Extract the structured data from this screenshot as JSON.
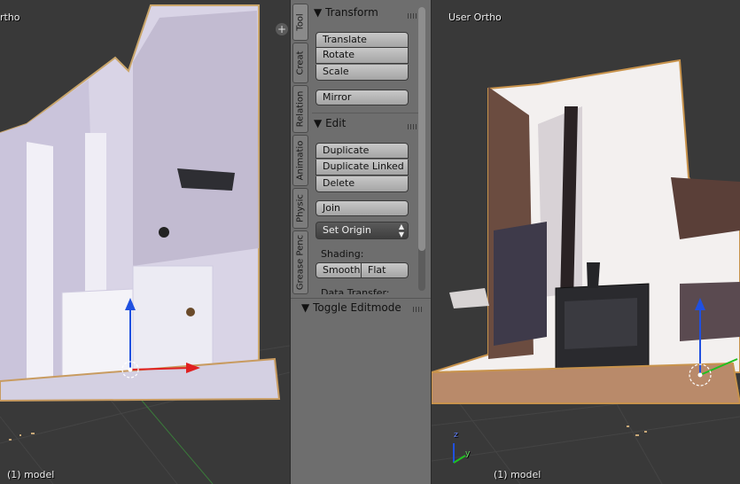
{
  "left_viewport": {
    "title_fragment": "rtho",
    "status": "(1) model"
  },
  "right_viewport": {
    "title": "User Ortho",
    "status": "(1) model",
    "axis_z": "z",
    "axis_y": "y"
  },
  "tool_shelf": {
    "tabs": [
      "Tool",
      "Creat",
      "Relation",
      "Animatio",
      "Physic",
      "Grease Penc"
    ],
    "transform": {
      "header": "Transform",
      "translate": "Translate",
      "rotate": "Rotate",
      "scale": "Scale",
      "mirror": "Mirror"
    },
    "edit": {
      "header": "Edit",
      "duplicate": "Duplicate",
      "duplicate_linked": "Duplicate Linked",
      "delete": "Delete",
      "join": "Join",
      "set_origin": "Set Origin",
      "shading_label": "Shading:",
      "smooth": "Smooth",
      "flat": "Flat",
      "data_transfer": "Data Transfer:"
    },
    "toggle_editmode": "Toggle Editmode",
    "add_icon": "plus-icon"
  },
  "colors": {
    "viewport_bg": "#393939",
    "shelf_bg": "#6e6e6e",
    "axis_x": "#e02020",
    "axis_y": "#20c020",
    "axis_z": "#2050e0"
  }
}
